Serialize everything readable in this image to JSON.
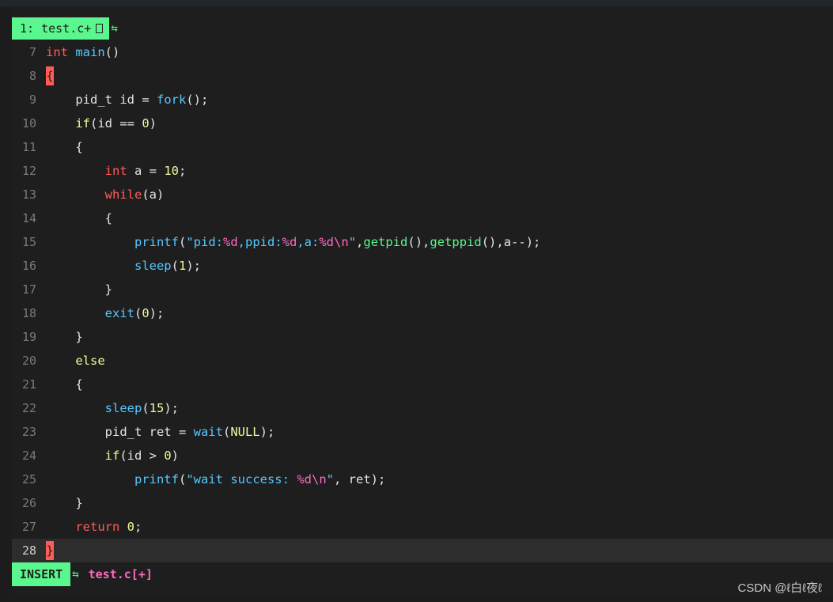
{
  "tabline": {
    "tab_label": "1: test.c+",
    "tab_icon": "file-glyph-icon",
    "separator": "⇆"
  },
  "code_lines": [
    {
      "n": "7",
      "text": "int main()"
    },
    {
      "n": "8",
      "text": "{"
    },
    {
      "n": "9",
      "text": "    pid_t id = fork();"
    },
    {
      "n": "10",
      "text": "    if(id == 0)"
    },
    {
      "n": "11",
      "text": "    {"
    },
    {
      "n": "12",
      "text": "        int a = 10;"
    },
    {
      "n": "13",
      "text": "        while(a)"
    },
    {
      "n": "14",
      "text": "        {"
    },
    {
      "n": "15",
      "text": "            printf(\"pid:%d,ppid:%d,a:%d\\n\",getpid(),getppid(),a--);"
    },
    {
      "n": "16",
      "text": "            sleep(1);"
    },
    {
      "n": "17",
      "text": "        }"
    },
    {
      "n": "18",
      "text": "        exit(0);"
    },
    {
      "n": "19",
      "text": "    }"
    },
    {
      "n": "20",
      "text": "    else"
    },
    {
      "n": "21",
      "text": "    {"
    },
    {
      "n": "22",
      "text": "        sleep(15);"
    },
    {
      "n": "23",
      "text": "        pid_t ret = wait(NULL);"
    },
    {
      "n": "24",
      "text": "        if(id > 0)"
    },
    {
      "n": "25",
      "text": "            printf(\"wait success: %d\\n\", ret);"
    },
    {
      "n": "26",
      "text": "    }"
    },
    {
      "n": "27",
      "text": "    return 0;"
    },
    {
      "n": "28",
      "text": "}"
    }
  ],
  "current_line": "28",
  "statusline": {
    "mode": "INSERT",
    "separator": "⇆",
    "filename": "test.c[+]"
  },
  "watermark": "CSDN @ℓ白ℓ夜ℓ",
  "colors": {
    "accent_green": "#5af78e",
    "keyword_red": "#ff5c57",
    "function_blue": "#57c7ff",
    "number_yellow": "#f3f99d",
    "format_pink": "#ff6ac1"
  }
}
